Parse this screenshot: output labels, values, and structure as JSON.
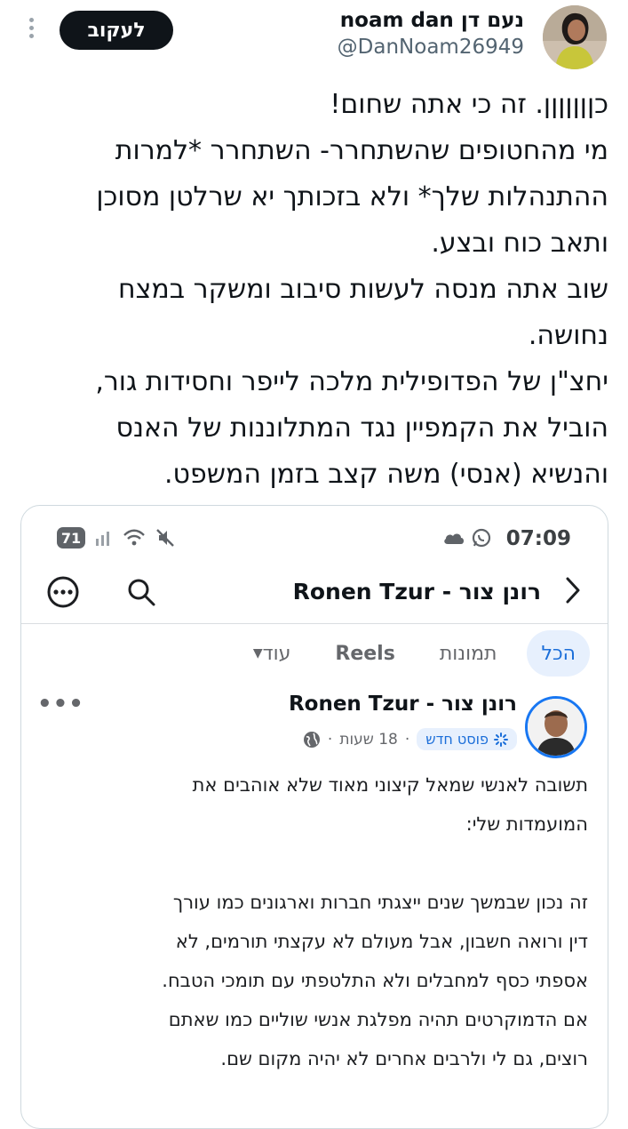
{
  "tweet": {
    "display_name": "נעם דן noam dan",
    "handle": "@DanNoam26949",
    "follow_label": "לעקוב",
    "text_lines": [
      "כןןןןןןן. זה כי אתה שחום!",
      "מי מהחטופים שהשתחרר- השתחרר *למרות",
      "ההתנהלות שלך* ולא בזכותך יא שרלטן מסוכן",
      "ותאב כוח ובצע.",
      "שוב אתה מנסה לעשות סיבוב ומשקר במצח",
      "נחושה.",
      "יחצ\"ן של הפדופילית מלכה לייפר וחסידות גור,",
      "הוביל את הקמפיין נגד המתלוננות של האנס",
      "והנשיא (אנסי) משה קצב בזמן המשפט."
    ]
  },
  "embedded": {
    "status_bar": {
      "time": "07:09",
      "battery": "71"
    },
    "header": {
      "title": "רונן צור - Ronen Tzur"
    },
    "tabs": [
      {
        "label": "הכל",
        "active": true
      },
      {
        "label": "תמונות",
        "active": false
      },
      {
        "label": "Reels",
        "active": false
      },
      {
        "label": "עוד",
        "active": false
      }
    ],
    "post": {
      "author": "רונן צור - Ronen Tzur",
      "badge": "פוסט חדש",
      "time_ago": "18 שעות",
      "separator": "·",
      "text_lines": [
        "תשובה לאנשי שמאל קיצוני מאוד שלא אוהבים את",
        "המועמדות שלי:",
        "",
        "זה נכון שבמשך שנים ייצגתי חברות וארגונים כמו עורך",
        "דין ורואה חשבון, אבל מעולם לא עקצתי תורמים, לא",
        "אספתי כסף למחבלים ולא התלטפתי עם תומכי הטבח.",
        "אם הדמוקרטים תהיה מפלגת אנשי שוליים כמו שאתם",
        "רוצים, גם לי ולרבים אחרים לא יהיה מקום שם."
      ]
    }
  },
  "colors": {
    "accent_blue": "#1b6ed9",
    "text": "#0f1419",
    "secondary": "#536471"
  }
}
